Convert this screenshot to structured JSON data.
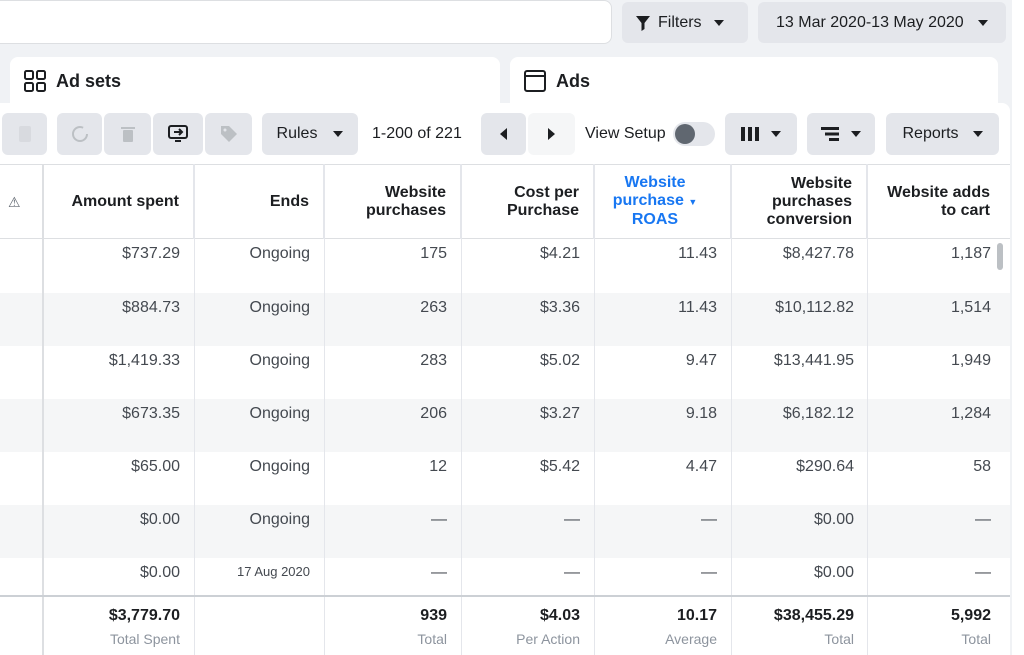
{
  "topbar": {
    "filters_label": "Filters",
    "date_range": "13 Mar 2020-13 May 2020"
  },
  "tabs": {
    "adsets_label": "Ad sets",
    "ads_label": "Ads"
  },
  "toolbar": {
    "rules_label": "Rules",
    "pagination": "1-200 of 221",
    "view_setup_label": "View Setup",
    "view_setup_on": false,
    "reports_label": "Reports"
  },
  "columns": {
    "amount_spent": "Amount spent",
    "ends": "Ends",
    "website_purchases_1": "Website",
    "website_purchases_2": "purchases",
    "cost_per_purchase_1": "Cost per",
    "cost_per_purchase_2": "Purchase",
    "roas_1": "Website",
    "roas_2": "purchase",
    "roas_3": "ROAS",
    "conv_1": "Website",
    "conv_2": "purchases",
    "conv_3": "conversion",
    "adds_1": "Website adds",
    "adds_2": "to cart"
  },
  "rows": [
    {
      "amount": "$737.29",
      "ends": "Ongoing",
      "purchases": "175",
      "cpp": "$4.21",
      "roas": "11.43",
      "conv": "$8,427.78",
      "adds": "1,187"
    },
    {
      "amount": "$884.73",
      "ends": "Ongoing",
      "purchases": "263",
      "cpp": "$3.36",
      "roas": "11.43",
      "conv": "$10,112.82",
      "adds": "1,514"
    },
    {
      "amount": "$1,419.33",
      "ends": "Ongoing",
      "purchases": "283",
      "cpp": "$5.02",
      "roas": "9.47",
      "conv": "$13,441.95",
      "adds": "1,949"
    },
    {
      "amount": "$673.35",
      "ends": "Ongoing",
      "purchases": "206",
      "cpp": "$3.27",
      "roas": "9.18",
      "conv": "$6,182.12",
      "adds": "1,284"
    },
    {
      "amount": "$65.00",
      "ends": "Ongoing",
      "purchases": "12",
      "cpp": "$5.42",
      "roas": "4.47",
      "conv": "$290.64",
      "adds": "58"
    },
    {
      "amount": "$0.00",
      "ends": "Ongoing",
      "purchases": "—",
      "cpp": "—",
      "roas": "—",
      "conv": "$0.00",
      "adds": "—"
    },
    {
      "amount": "$0.00",
      "ends": "17 Aug 2020",
      "purchases": "—",
      "cpp": "—",
      "roas": "—",
      "conv": "$0.00",
      "adds": "—"
    }
  ],
  "totals": {
    "amount": "$3,779.70",
    "amount_label": "Total Spent",
    "purchases": "939",
    "purchases_label": "Total",
    "cpp": "$4.03",
    "cpp_label": "Per Action",
    "roas": "10.17",
    "roas_label": "Average",
    "conv": "$38,455.29",
    "conv_label": "Total",
    "adds": "5,992",
    "adds_label": "Total"
  }
}
